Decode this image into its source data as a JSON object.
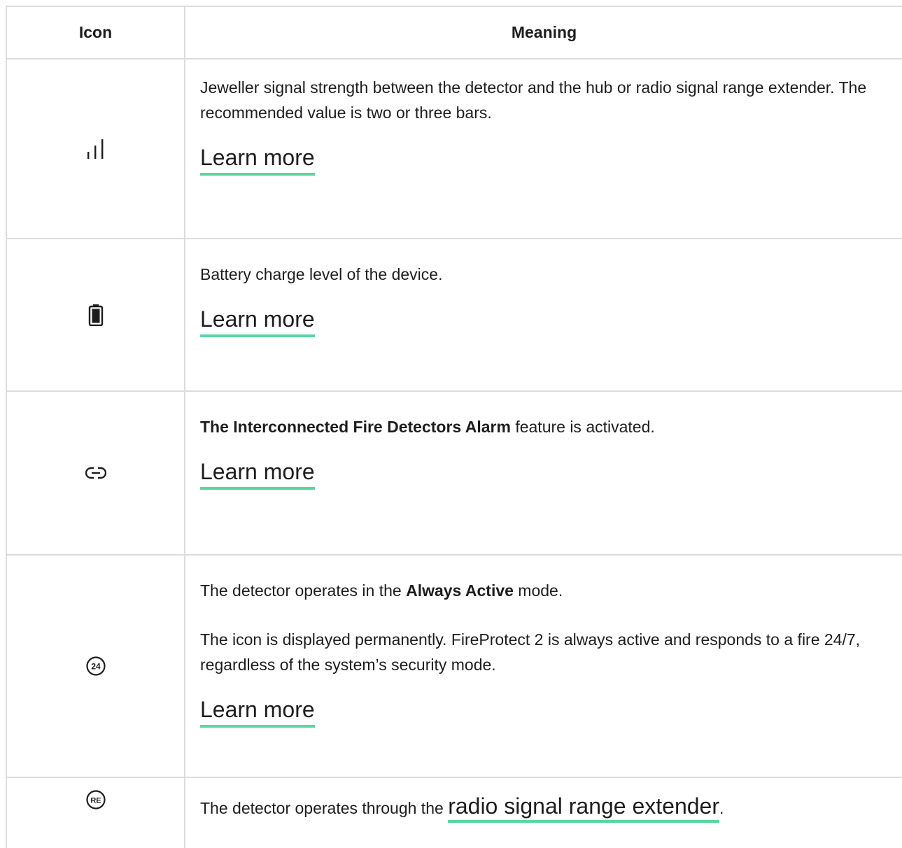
{
  "table": {
    "header": {
      "icon_col": "Icon",
      "meaning_col": "Meaning"
    },
    "rows": [
      {
        "icon": "signal-bars-icon",
        "text": "Jeweller signal strength between the detector and the hub or radio signal range extender. The recommended value is two or three bars.",
        "link": "Learn more"
      },
      {
        "icon": "battery-icon",
        "text": "Battery charge level of the device.",
        "link": "Learn more"
      },
      {
        "icon": "link-icon",
        "bold": "The Interconnected Fire Detectors Alarm",
        "text_after": " feature is activated.",
        "link": "Learn more"
      },
      {
        "icon": "24-hours-icon",
        "icon_text": "24",
        "text_before": "The detector operates in the ",
        "bold": "Always Active",
        "text_after": " mode.",
        "text2": "The icon is displayed permanently. FireProtect 2 is always active and responds to a fire 24/7, regardless of the system’s security mode.",
        "link": "Learn more"
      },
      {
        "icon": "range-extender-icon",
        "icon_text": "RE",
        "text_before": "The detector operates through the ",
        "link": "radio signal range extender",
        "text_after": "."
      }
    ]
  },
  "colors": {
    "link_underline": "#5ad6a0",
    "border": "#dcdcdc",
    "text": "#1d1d1d"
  }
}
